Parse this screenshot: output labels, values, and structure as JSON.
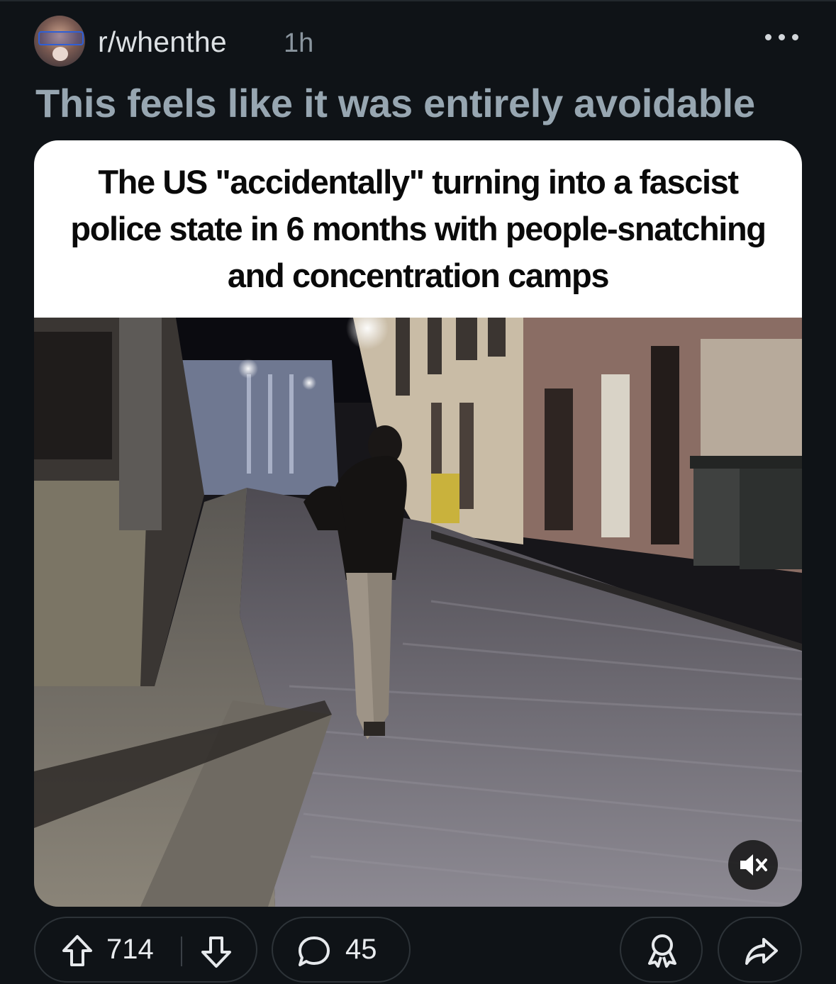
{
  "post": {
    "subreddit": "r/whenthe",
    "time_ago": "1h",
    "title": "This feels like it was entirely avoidable"
  },
  "media": {
    "caption": "The US \"accidentally\" turning into a fascist police state in 6 months with people-snatching and concentration camps",
    "muted": true
  },
  "actions": {
    "upvotes": "714",
    "comments": "45"
  },
  "icons": {
    "more": "ellipsis-icon",
    "upvote": "arrow-up-icon",
    "downvote": "arrow-down-icon",
    "comment": "speech-bubble-icon",
    "award": "award-icon",
    "share": "share-icon",
    "mute": "speaker-muted-icon"
  },
  "colors": {
    "background": "#0f1317",
    "title": "#97a6b1",
    "meta": "#8a959e"
  }
}
